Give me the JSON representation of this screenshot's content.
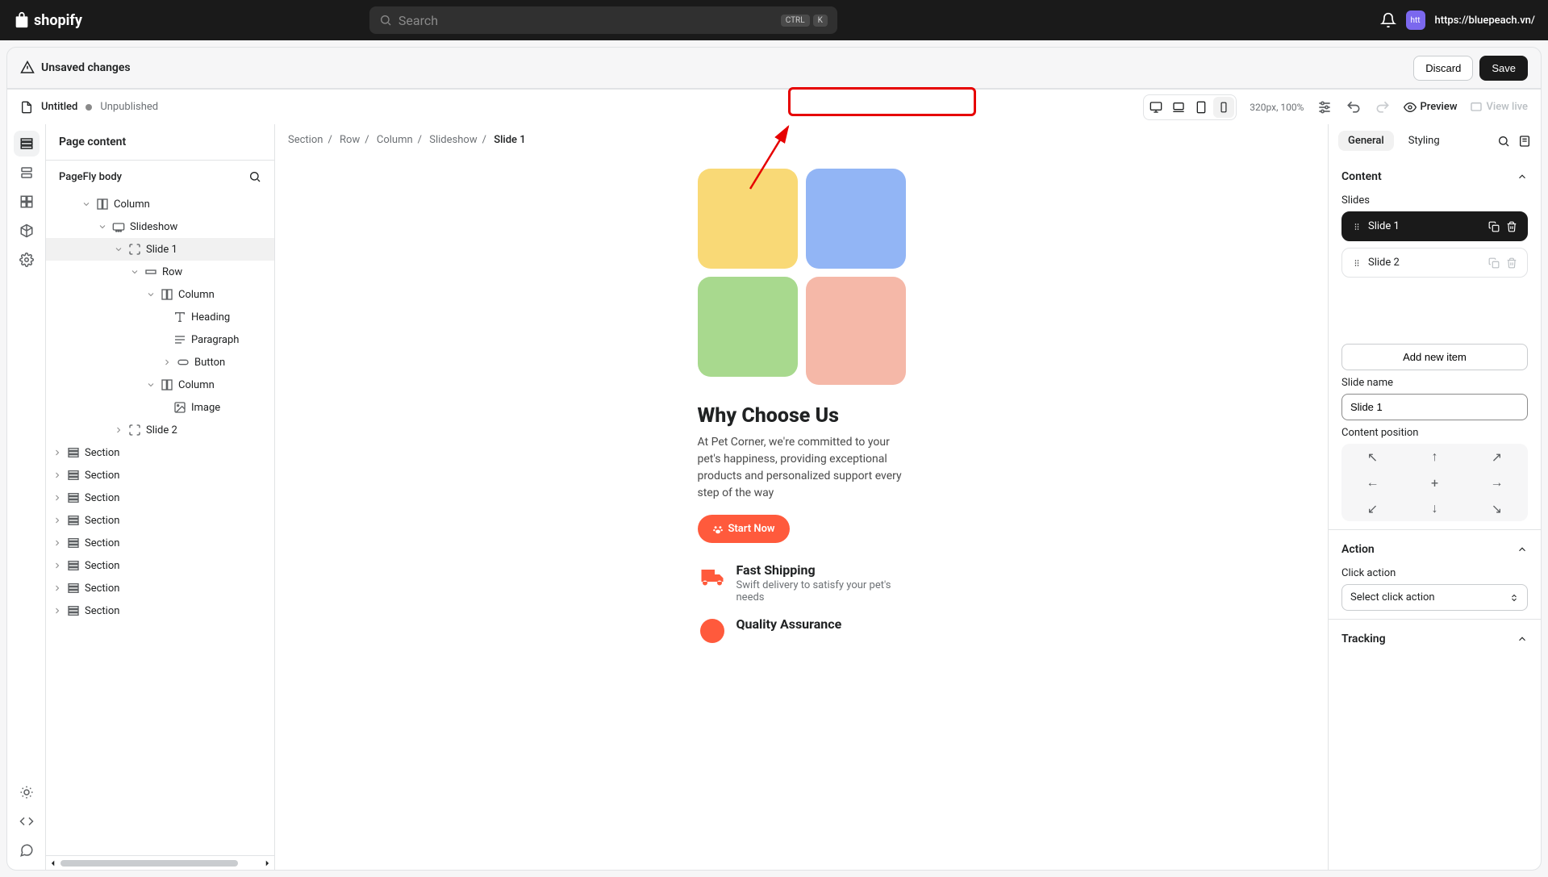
{
  "top_bar": {
    "brand": "shopify",
    "search_placeholder": "Search",
    "kbd_ctrl": "CTRL",
    "kbd_k": "K",
    "avatar_text": "htt",
    "store_url": "https://bluepeach.vn/"
  },
  "unsaved_bar": {
    "title": "Unsaved changes",
    "discard": "Discard",
    "save": "Save"
  },
  "toolbar": {
    "page_title": "Untitled",
    "status": "Unpublished",
    "zoom": "320px, 100%",
    "preview": "Preview",
    "view_live": "View live"
  },
  "content_panel": {
    "header": "Page content",
    "body_label": "PageFly body",
    "tree": {
      "column": "Column",
      "slideshow": "Slideshow",
      "slide1": "Slide 1",
      "row": "Row",
      "column2": "Column",
      "heading": "Heading",
      "paragraph": "Paragraph",
      "button": "Button",
      "column3": "Column",
      "image": "Image",
      "slide2": "Slide 2",
      "section": "Section"
    }
  },
  "breadcrumb": {
    "section": "Section",
    "row": "Row",
    "column": "Column",
    "slideshow": "Slideshow",
    "current": "Slide 1"
  },
  "preview": {
    "heading": "Why Choose Us",
    "paragraph": "At Pet Corner, we're committed to your pet's happiness, providing exceptional products and personalized support every step of the way",
    "button": "Start Now",
    "feature1_title": "Fast Shipping",
    "feature1_desc": "Swift delivery to satisfy your pet's needs",
    "feature2_title": "Quality Assurance"
  },
  "settings": {
    "tab_general": "General",
    "tab_styling": "Styling",
    "content_header": "Content",
    "slides_label": "Slides",
    "slide1": "Slide 1",
    "slide2": "Slide 2",
    "add_item": "Add new item",
    "slide_name_label": "Slide name",
    "slide_name_value": "Slide 1",
    "position_label": "Content position",
    "action_header": "Action",
    "click_action_label": "Click action",
    "click_action_value": "Select click action",
    "tracking_header": "Tracking"
  }
}
